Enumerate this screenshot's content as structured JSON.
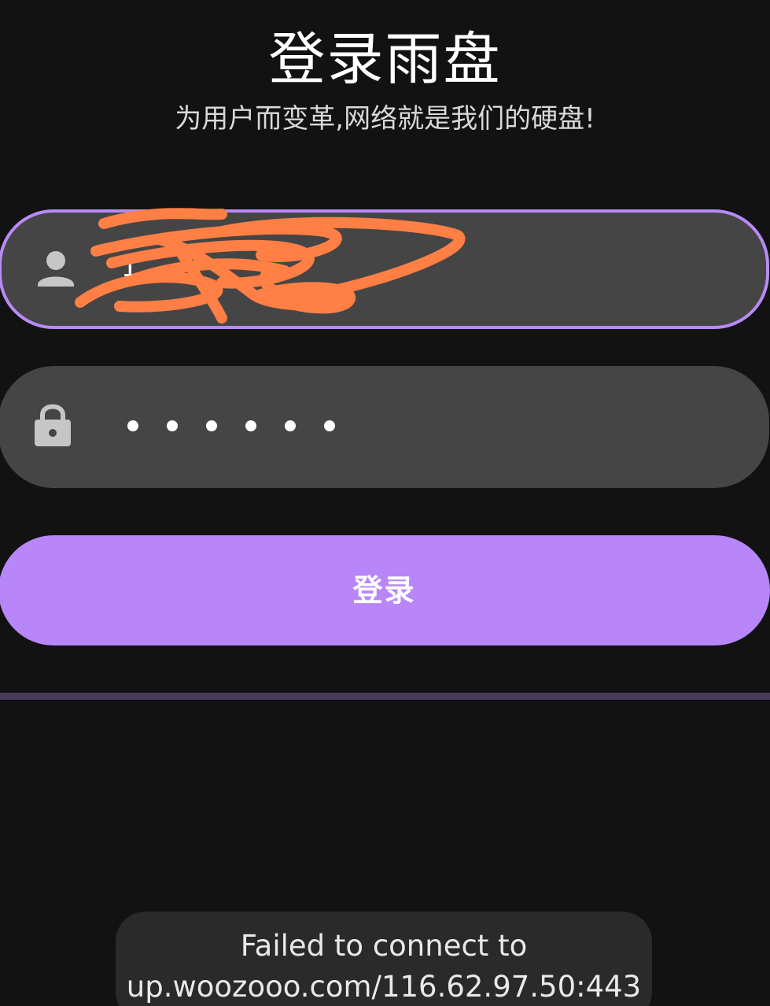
{
  "header": {
    "title": "登录雨盘",
    "subtitle": "为用户而变革,网络就是我们的硬盘!"
  },
  "form": {
    "username": {
      "icon": "person-icon",
      "visible_value": "1"
    },
    "password": {
      "icon": "lock-icon",
      "masked_char_count": 6
    },
    "login_label": "登录"
  },
  "colors": {
    "background": "#121212",
    "field_background": "#454545",
    "accent": "#b886f8",
    "focus_border": "#b98af5",
    "redaction_scribble": "#ff7f45"
  },
  "toast": {
    "line1": "Failed to connect to",
    "line2": "up.woozooo.com/116.62.97.50:443"
  }
}
